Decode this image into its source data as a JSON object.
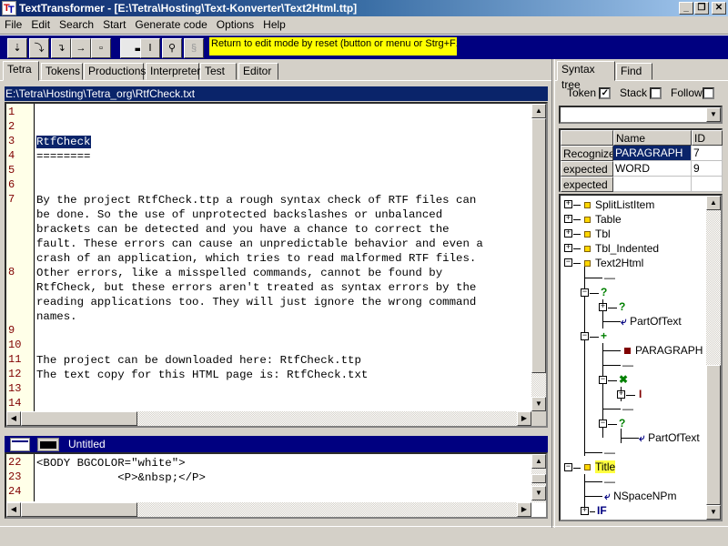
{
  "window": {
    "title": "TextTransformer - [E:\\Tetra\\Hosting\\Text-Konverter\\Text2Html.ttp]",
    "minimize": "_",
    "restore": "❐",
    "close": "✕"
  },
  "menu": [
    "File",
    "Edit",
    "Search",
    "Start",
    "Generate code",
    "Options",
    "Help"
  ],
  "toolbar": {
    "buttons": [
      {
        "icon": "step-into-icon",
        "glyph": "⇣"
      },
      {
        "icon": "step-over-icon",
        "glyph": "⤵"
      },
      {
        "icon": "step-out-icon",
        "glyph": "↴"
      },
      {
        "icon": "run-to-cursor-icon",
        "glyph": "→"
      },
      {
        "icon": "stop-icon",
        "glyph": "▫"
      },
      {
        "icon": "toggle-view-icon",
        "glyph": "▬"
      },
      {
        "icon": "text-cursor-icon",
        "glyph": "Ⅰ"
      },
      {
        "icon": "search-icon",
        "glyph": "⚲"
      },
      {
        "icon": "reset-icon",
        "glyph": "§"
      }
    ],
    "hint": "Return to edit mode by reset (button or menu or Strg+F12)"
  },
  "left_tabs": [
    "Tetra",
    "Tokens",
    "Productions",
    "Interpreter",
    "Test",
    "Editor"
  ],
  "active_left_tab": "Tetra",
  "path": "E:\\Tetra\\Hosting\\Tetra_org\\RtfCheck.txt",
  "editor": {
    "line_numbers": [
      {
        "n": "1",
        "row": 0
      },
      {
        "n": "2",
        "row": 1
      },
      {
        "n": "3",
        "row": 2
      },
      {
        "n": "4",
        "row": 3
      },
      {
        "n": "5",
        "row": 4
      },
      {
        "n": "6",
        "row": 5
      },
      {
        "n": "7",
        "row": 6
      },
      {
        "n": "8",
        "row": 11
      },
      {
        "n": "9",
        "row": 15
      },
      {
        "n": "10",
        "row": 16
      },
      {
        "n": "11",
        "row": 17
      },
      {
        "n": "12",
        "row": 18
      },
      {
        "n": "13",
        "row": 19
      },
      {
        "n": "14",
        "row": 20
      }
    ],
    "lines": [
      "",
      "",
      "RtfCheck",
      "========",
      "",
      "",
      "By the project RtfCheck.ttp a rough syntax check of RTF files can",
      "be done. So the use of unprotected backslashes or unbalanced",
      "brackets can be detected and you have a chance to correct the",
      "fault. These errors can cause an unpredictable behavior and even a",
      "crash of an application, which tries to read malformed RTF files.",
      "Other errors, like a misspelled commands, cannot be found by",
      "RtfCheck, but these errors aren't treated as syntax errors by the",
      "reading applications too. They will just ignore the wrong command",
      "names.",
      "",
      "",
      "The project can be downloaded here: RtfCheck.ttp",
      "The text copy for this HTML page is: RtfCheck.txt",
      "",
      ""
    ],
    "selected_text": "RtfCheck"
  },
  "output": {
    "title": "Untitled",
    "line_numbers": [
      "22",
      "23",
      "24"
    ],
    "lines": [
      "<BODY BGCOLOR=\"white\">",
      "            <P>&nbsp;</P>",
      ""
    ]
  },
  "right_panel": {
    "tabs": [
      "Syntax tree",
      "Find"
    ],
    "active_tab": "Syntax tree",
    "checkboxes": [
      {
        "label": "Token",
        "checked": true
      },
      {
        "label": "Stack",
        "checked": false
      },
      {
        "label": "Follow",
        "checked": false
      }
    ],
    "combo_value": "",
    "grid": {
      "headers": [
        "",
        "Name",
        "ID"
      ],
      "rows": [
        [
          "Recognized",
          "PARAGRAPH",
          "7"
        ],
        [
          "expected",
          "WORD",
          "9"
        ],
        [
          "expected",
          "",
          ""
        ]
      ]
    },
    "tree": [
      {
        "label": "SplitListItem",
        "kind": "production"
      },
      {
        "label": "Table",
        "kind": "production"
      },
      {
        "label": "Tbl",
        "kind": "production"
      },
      {
        "label": "Tbl_Indented",
        "kind": "production"
      },
      {
        "label": "Text2Html",
        "kind": "production"
      },
      {
        "label": "—",
        "kind": "sequence"
      },
      {
        "label": "?",
        "kind": "option"
      },
      {
        "label": "?",
        "kind": "option"
      },
      {
        "label": "PartOfText",
        "kind": "call"
      },
      {
        "label": "+",
        "kind": "repeat"
      },
      {
        "label": "PARAGRAPH",
        "kind": "token"
      },
      {
        "label": "—",
        "kind": "sequence"
      },
      {
        "label": "✖",
        "kind": "repeat-star"
      },
      {
        "label": "I",
        "kind": "alternative"
      },
      {
        "label": "—",
        "kind": "sequence"
      },
      {
        "label": "?",
        "kind": "option"
      },
      {
        "label": "PartOfText",
        "kind": "call"
      },
      {
        "label": "—",
        "kind": "sequence"
      },
      {
        "label": "Title",
        "kind": "production-highlighted"
      },
      {
        "label": "—",
        "kind": "sequence"
      },
      {
        "label": "NSpaceNPm",
        "kind": "call"
      },
      {
        "label": "IF",
        "kind": "keyword"
      }
    ]
  },
  "colors": {
    "title_gradient_start": "#0a246a",
    "toolbar_bg": "#000080",
    "hint_bg": "#ffff00",
    "selection": "#0a246a",
    "gutter_bg": "#ffffe8",
    "line_number": "#800000",
    "tree_green": "#008000",
    "tree_blue": "#000080",
    "tree_maroon": "#800000"
  }
}
